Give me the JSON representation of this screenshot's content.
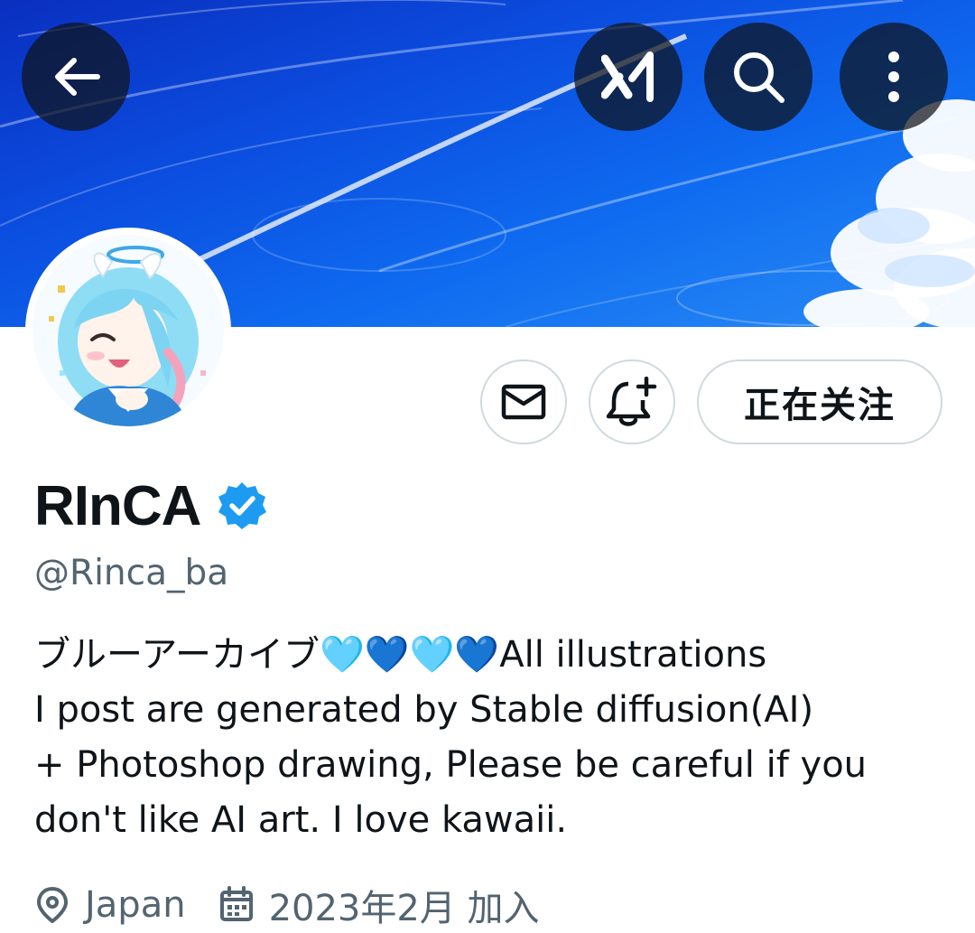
{
  "header": {
    "back_icon": "arrow-left-icon",
    "grok_icon": "grok-icon",
    "search_icon": "search-icon",
    "more_icon": "more-vertical-icon"
  },
  "profile": {
    "display_name": "RInCA",
    "verified_icon": "verified-badge-icon",
    "handle": "@Rinca_ba",
    "bio": "ブルーアーカイブ🩵💙🩵💙All illustrations\nI post are generated by Stable diffusion(AI)\n+ Photoshop drawing, Please be careful if you\ndon't like AI art. I love kawaii.",
    "location": "Japan",
    "joined": "2023年2月 加入"
  },
  "actions": {
    "message_icon": "mail-icon",
    "notify_icon": "bell-plus-icon",
    "follow_label": "正在关注"
  },
  "colors": {
    "text_primary": "#0f1419",
    "text_secondary": "#536471",
    "verified_blue": "#1d9bf0",
    "button_border": "#cfd9de"
  }
}
